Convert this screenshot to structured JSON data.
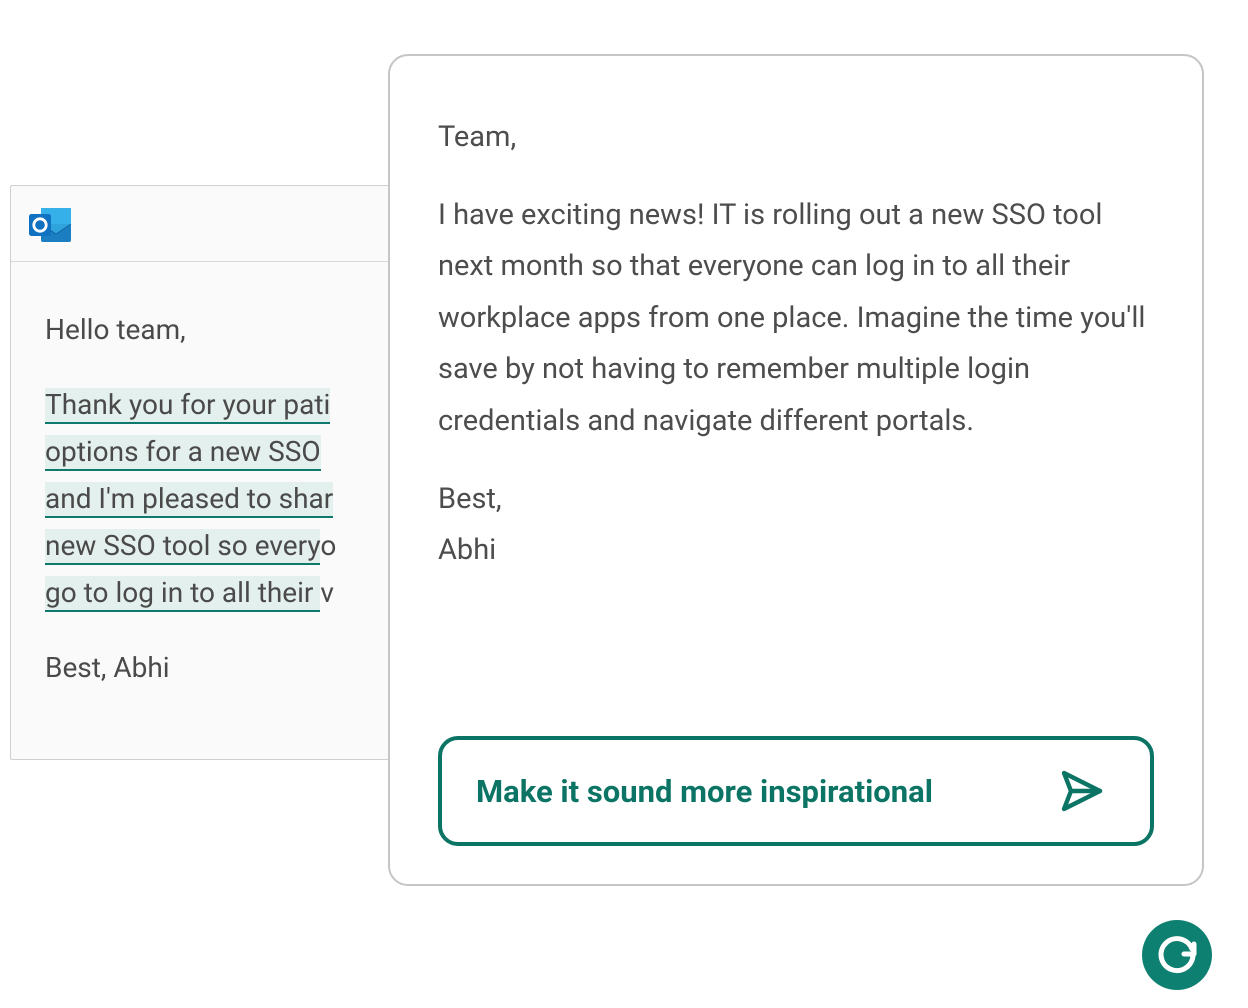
{
  "colors": {
    "accent": "#0b7464",
    "highlight_bg": "#e4f0ed",
    "text": "#4a4a4a"
  },
  "outlook": {
    "greeting": "Hello team,",
    "highlighted_lines": [
      "Thank you for your pati",
      "options for a new SSO ",
      "and I'm pleased to shar",
      "new SSO tool so every",
      "go to log in to all their "
    ],
    "trailing_chars": [
      "",
      "",
      "",
      "o",
      "v"
    ],
    "signature": "Best, Abhi"
  },
  "suggestion": {
    "greeting": "Team,",
    "body": "I have exciting news! IT is rolling out a new SSO tool next month so that everyone can log in to all their workplace apps from one place. Imagine the time you'll save by not having to remember multiple login credentials and navigate different portals.",
    "closing": "Best,",
    "name": "Abhi"
  },
  "prompt": {
    "label": "Make it sound more inspirational"
  },
  "icons": {
    "outlook": "outlook-icon",
    "send": "send-icon",
    "grammarly": "grammarly-icon"
  }
}
